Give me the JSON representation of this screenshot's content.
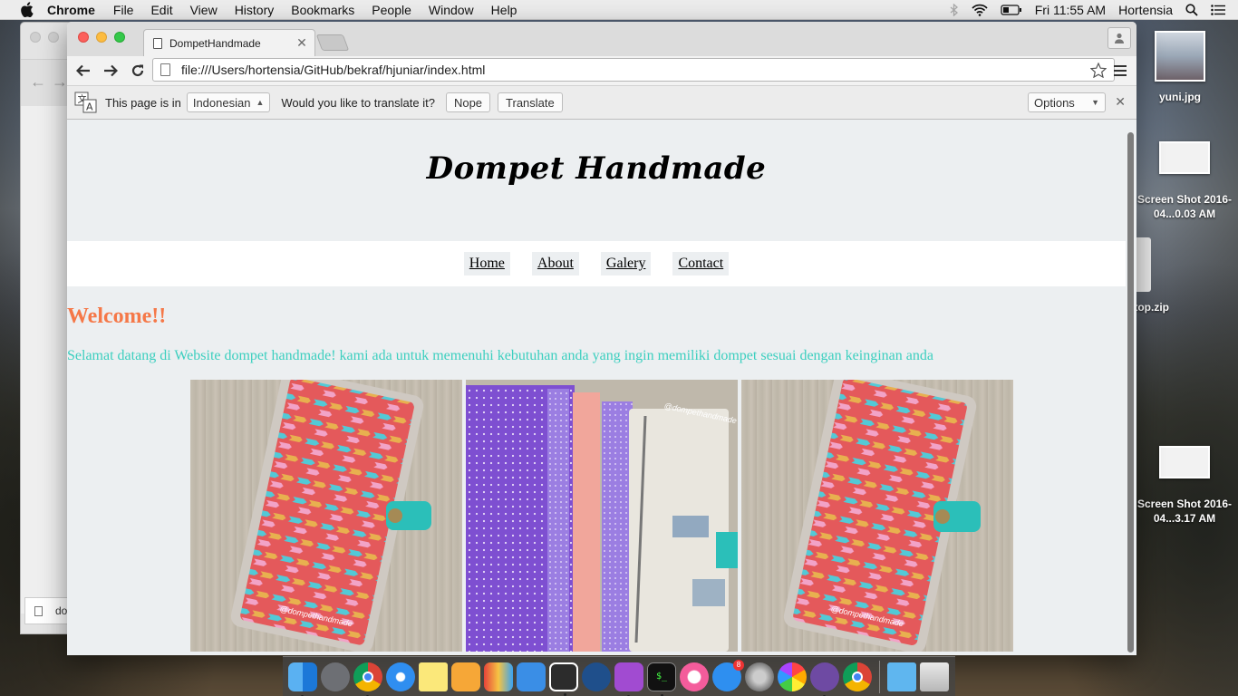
{
  "menubar": {
    "app_name": "Chrome",
    "items": [
      "File",
      "Edit",
      "View",
      "History",
      "Bookmarks",
      "People",
      "Window",
      "Help"
    ],
    "clock": "Fri 11:55 AM",
    "user": "Hortensia"
  },
  "browser": {
    "tab_title": "DompetHandmade",
    "url": "file:///Users/hortensia/GitHub/bekraf/hjuniar/index.html",
    "translate_bar": {
      "page_is_in": "This page is in",
      "language": "Indonesian",
      "question": "Would you like to translate it?",
      "nope": "Nope",
      "translate": "Translate",
      "options": "Options"
    }
  },
  "page": {
    "title": "Dompet Handmade",
    "nav": [
      "Home",
      "About",
      "Galery",
      "Contact"
    ],
    "heading": "Welcome!!",
    "intro": "Selamat datang di Website dompet handmade! kami ada untuk memenuhi kebutuhan anda yang ingin memiliki dompet sesuai dengan keinginan anda",
    "watermark": "@dompethandmade",
    "colors": {
      "heading": "#f57848",
      "intro": "#3ccfbf",
      "background": "#eceff1"
    }
  },
  "desktop": {
    "icons": [
      {
        "label": "yuni.jpg"
      },
      {
        "label": "Screen Shot 2016-04...0.03 AM"
      },
      {
        "label": "Desktop.zip"
      },
      {
        "label": "Screen Shot 2016-04...3.17 AM"
      }
    ]
  },
  "background_window": {
    "download_label": "do"
  },
  "dock": {
    "apps": [
      "Finder",
      "Launchpad",
      "Chrome",
      "Safari",
      "Notes",
      "Pages",
      "Keynote",
      "Preview",
      "Xcode",
      "Sourcetree",
      "Dash",
      "Terminal",
      "iTunes",
      "App Store",
      "System Preferences",
      "Photos",
      "GitHub Desktop",
      "Chrome Canary",
      "Downloads",
      "Trash"
    ],
    "app_store_badge": "8"
  }
}
